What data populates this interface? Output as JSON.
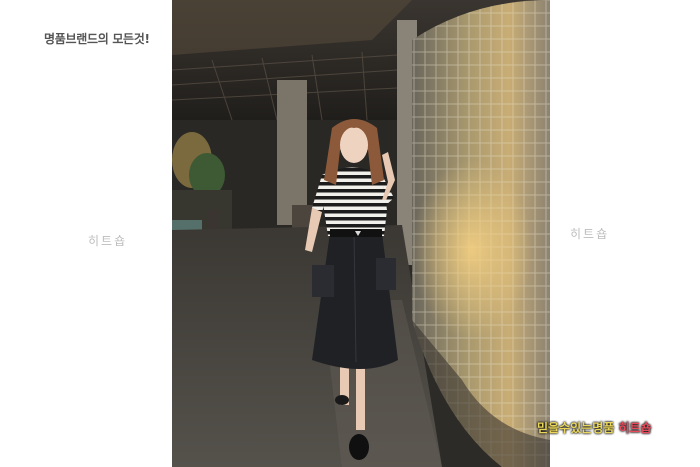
{
  "tagline": "명품브랜드의 모든것!",
  "watermark_left": "히트숍",
  "watermark_right": "히트숍",
  "badge": {
    "part1": "믿을수있는명품",
    "part2": "히트숍"
  },
  "colors": {
    "tagline": "#555555",
    "watermark": "#bdbdbd",
    "badge_yellow": "#e9d65a",
    "badge_red": "#e94a5c"
  }
}
